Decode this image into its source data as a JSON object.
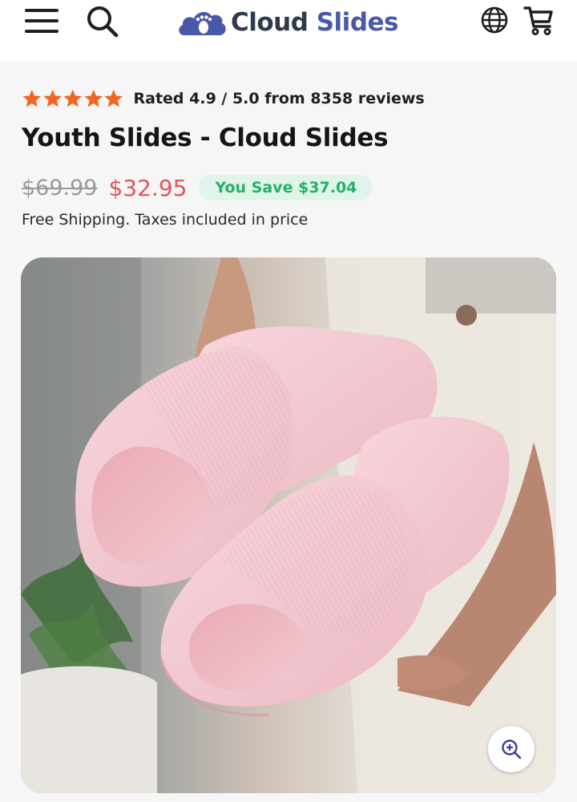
{
  "header": {
    "logo": {
      "word1": "Cloud",
      "word2": "Slides"
    },
    "icons": [
      "menu-icon",
      "search-icon",
      "globe-icon",
      "cart-icon"
    ]
  },
  "product": {
    "rating_text": "Rated 4.9 / 5.0 from 8358 reviews",
    "stars": 5,
    "title": "Youth Slides - Cloud Slides",
    "old_price": "$69.99",
    "new_price": "$32.95",
    "save_badge": "You Save $37.04",
    "shipping_note": "Free Shipping. Taxes included in price"
  },
  "colors": {
    "star": "#f26522",
    "sale_price": "#e0555c",
    "save_text": "#27b06a",
    "save_bg": "#e1f4ea",
    "logo_dark": "#2f3a4c",
    "logo_blue": "#4a58a8",
    "slide_pink": "#f2c6cf"
  }
}
